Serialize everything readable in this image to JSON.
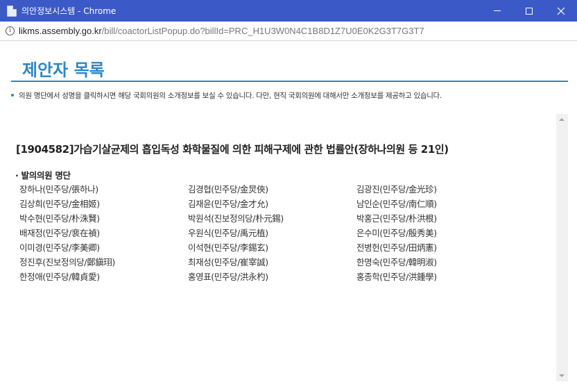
{
  "window": {
    "title": "의안정보시스템 - Chrome",
    "icon": "document-icon"
  },
  "address": {
    "host": "likms.assembly.go.kr",
    "path": "/bill/coactorListPopup.do?billId=PRC_H1U3W0N4C1B8D1Z7U0E0K2G3T7G3T7"
  },
  "page": {
    "title": "제안자 목록",
    "notice": "의원 명단에서 성명을 클릭하시면 해당 국회의원의 소개정보를 보실 수 있습니다. 다만, 현직 국회의원에 대해서만 소개정보를 제공하고 있습니다.",
    "bill_title": "[1904582]가습기살균제의 흡입독성 화학물질에 의한 피해구제에 관한 법률안(장하나의원 등 21인)",
    "section_heading": "· 발의의원 명단",
    "proposers": [
      [
        "장하나(민주당/張하나)",
        "김경협(민주당/金炅俠)",
        "김광진(민주당/金光珍)"
      ],
      [
        "김상희(민주당/金相姬)",
        "김재윤(민주당/金才允)",
        "남인순(민주당/南仁順)"
      ],
      [
        "박수현(민주당/朴洙賢)",
        "박원석(진보정의당/朴元錫)",
        "박홍근(민주당/朴洪根)"
      ],
      [
        "배재정(민주당/裵在禎)",
        "우원식(민주당/禹元植)",
        "은수미(민주당/殷秀美)"
      ],
      [
        "이미경(민주당/李美卿)",
        "이석현(민주당/李錫玄)",
        "전병헌(민주당/田炳憲)"
      ],
      [
        "정진후(진보정의당/鄭鎭珝)",
        "최재성(민주당/崔宰誠)",
        "한명숙(민주당/韓明淑)"
      ],
      [
        "한정애(민주당/韓貞愛)",
        "홍영표(민주당/洪永杓)",
        "홍종학(민주당/洪鍾學)"
      ]
    ]
  },
  "colors": {
    "titlebar": "#3b5ac7",
    "accent": "#2b87c8"
  }
}
